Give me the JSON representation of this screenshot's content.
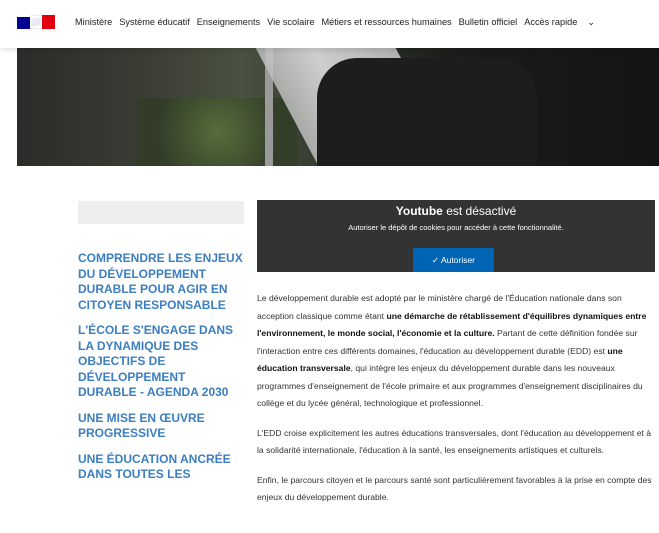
{
  "nav": {
    "items": [
      "Ministère",
      "Système éducatif",
      "Enseignements",
      "Vie scolaire",
      "Métiers et ressources humaines",
      "Bulletin officiel"
    ],
    "quick_access": "Accès rapide"
  },
  "sidebar": {
    "sections": [
      "Comprendre les enjeux du développement durable pour agir en citoyen responsable",
      "L'école s'engage dans la dynamique des objectifs de développement durable - Agenda 2030",
      "Une mise en œuvre progressive",
      "Une éducation ancrée dans toutes les"
    ]
  },
  "youtube": {
    "title_brand": "Youtube",
    "title_rest": "est désactivé",
    "subtitle": "Autoriser le dépôt de cookies pour accéder à cette fonctionnalité.",
    "button": "✓ Autoriser"
  },
  "content": {
    "p1_a": "Le développement durable est adopté par le ministère chargé de l'Éducation nationale dans son acception classique comme étant ",
    "p1_b": "une démarche de rétablissement d'équilibres dynamiques entre l'environnement, le monde social, l'économie et la culture.",
    "p1_c": " Partant de cette définition fondée sur l'interaction entre ces différents domaines, l'éducation au développement durable (EDD) est ",
    "p1_d": "une éducation transversale",
    "p1_e": ", qui intègre les enjeux du développement durable dans les nouveaux programmes d'enseignement de l'école primaire et aux programmes d'enseignement disciplinaires du collège et du lycée général, technologique et professionnel.",
    "p2": "L'EDD croise explicitement les autres éducations transversales, dont l'éducation au développement et à la solidarité internationale, l'éducation à la santé, les enseignements artistiques et culturels.",
    "p3": "Enfin, le parcours citoyen et le parcours santé sont particulièrement favorables à la prise en compte des enjeux du développement durable."
  }
}
